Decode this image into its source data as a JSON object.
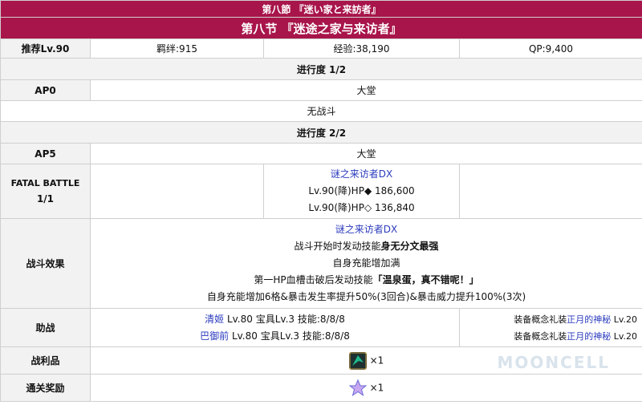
{
  "header": {
    "jp_title": "第八節 『迷い家と来訪者』",
    "cn_title": "第八节 『迷途之家与来访者』"
  },
  "info": {
    "recommend": "推荐Lv.90",
    "bond": "羁绊:915",
    "exp": "经验:38,190",
    "qp": "QP:9,400"
  },
  "progress1": {
    "label": "进行度 1/2",
    "ap_label": "AP0",
    "location": "大堂",
    "no_battle": "无战斗"
  },
  "progress2": {
    "label": "进行度 2/2",
    "ap_label": "AP5",
    "location": "大堂"
  },
  "fatal": {
    "label": "FATAL BATTLE",
    "count": "1/1",
    "enemy_name": "谜之来访者DX",
    "hp1": "Lv.90(降)HP◆ 186,600",
    "hp2": "Lv.90(降)HP◇ 136,840"
  },
  "effects": {
    "label": "战斗效果",
    "name": "谜之来访者DX",
    "line1_prefix": "战斗开始时发动技能",
    "line1_bold": "身无分文最强",
    "line2": "自身充能增加满",
    "line3_prefix": "第一HP血槽击破后发动技能",
    "line3_bold": "「温泉蛋，真不错呢！」",
    "line4": "自身充能增加6格&暴击发生率提升50%(3回合)&暴击威力提升100%(3次)"
  },
  "support": {
    "label": "助战",
    "s1_name": "清姬",
    "s1_stats": " Lv.80 宝具Lv.3 技能:8/8/8",
    "s1_ce_prefix": "装备概念礼装",
    "s1_ce_name": "正月的神秘",
    "s1_ce_lv": " Lv.20",
    "s2_name": "巴御前",
    "s2_stats": " Lv.80 宝具Lv.3 技能:8/8/8",
    "s2_ce_prefix": "装备概念礼装",
    "s2_ce_name": "正月的神秘",
    "s2_ce_lv": " Lv.20"
  },
  "drops": {
    "label": "战利品",
    "qty": "×1"
  },
  "reward": {
    "label": "通关奖励",
    "qty": "×1"
  },
  "watermark": "MOONCELL",
  "colors": {
    "header_bg": "#a8154a",
    "link": "#2b3bbd"
  }
}
